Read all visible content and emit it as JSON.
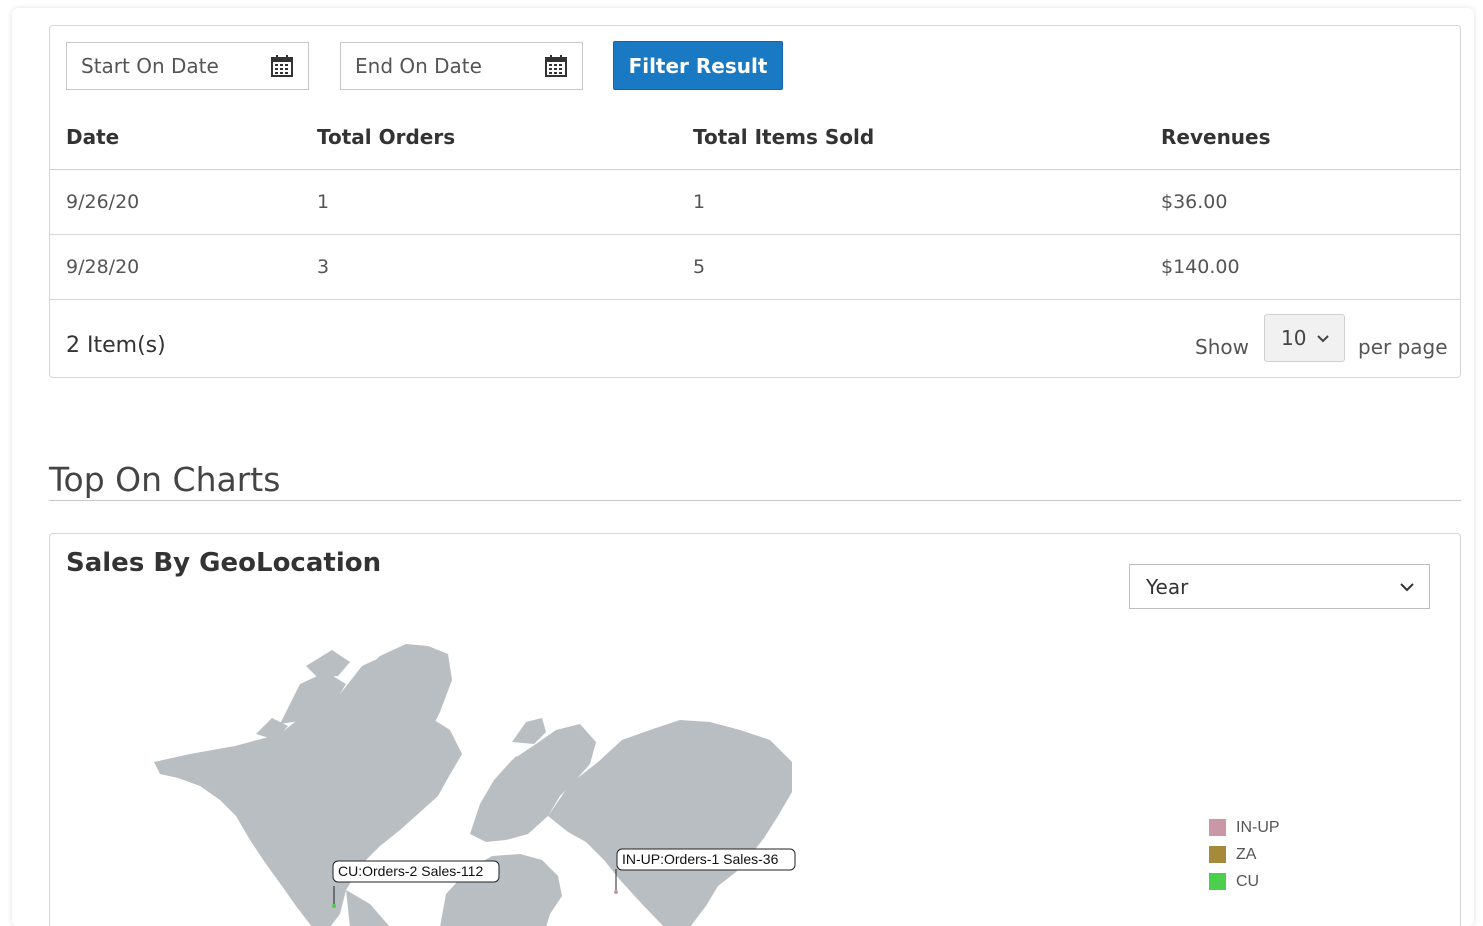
{
  "filters": {
    "start_date_placeholder": "Start On Date",
    "end_date_placeholder": "End On Date",
    "filter_button": "Filter Result"
  },
  "table": {
    "headers": [
      "Date",
      "Total Orders",
      "Total Items Sold",
      "Revenues"
    ],
    "rows": [
      [
        "9/26/20",
        "1",
        "1",
        "$36.00"
      ],
      [
        "9/28/20",
        "3",
        "5",
        "$140.00"
      ]
    ]
  },
  "pager": {
    "items_count": "2 Item(s)",
    "show_label": "Show",
    "per_page_value": "10",
    "per_page_label": "per page"
  },
  "charts_section": {
    "heading": "Top On Charts"
  },
  "geo_chart": {
    "title": "Sales By GeoLocation",
    "period_select": "Year",
    "tooltips": {
      "cu": "CU:Orders-2 Sales-112",
      "in_up": "IN-UP:Orders-1 Sales-36"
    },
    "legend": [
      {
        "label": "IN-UP",
        "color": "#c997a6"
      },
      {
        "label": "ZA",
        "color": "#a58a3b"
      },
      {
        "label": "CU",
        "color": "#4ccf4c"
      }
    ],
    "land_color": "#b8bec2"
  },
  "colors": {
    "primary_button": "#1979c3"
  }
}
